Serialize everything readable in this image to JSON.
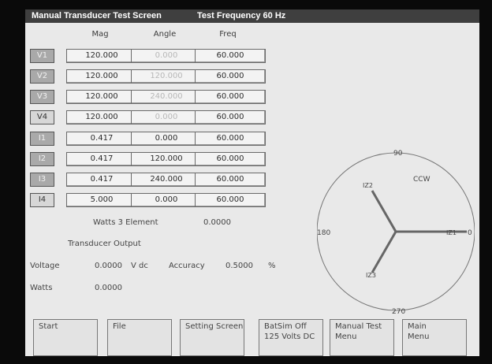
{
  "title": {
    "screen_name": "Manual Transducer Test Screen",
    "frequency": "Test Frequency 60 Hz"
  },
  "columns": {
    "mag": "Mag",
    "angle": "Angle",
    "freq": "Freq"
  },
  "rows": [
    {
      "channel": "V1",
      "mag": "120.000",
      "angle": "0.000",
      "freq": "60.000"
    },
    {
      "channel": "V2",
      "mag": "120.000",
      "angle": "120.000",
      "freq": "60.000"
    },
    {
      "channel": "V3",
      "mag": "120.000",
      "angle": "240.000",
      "freq": "60.000"
    },
    {
      "channel": "V4",
      "mag": "120.000",
      "angle": "0.000",
      "freq": "60.000"
    },
    {
      "channel": "I1",
      "mag": "0.417",
      "angle": "0.000",
      "freq": "60.000"
    },
    {
      "channel": "I2",
      "mag": "0.417",
      "angle": "120.000",
      "freq": "60.000"
    },
    {
      "channel": "I3",
      "mag": "0.417",
      "angle": "240.000",
      "freq": "60.000"
    },
    {
      "channel": "I4",
      "mag": "5.000",
      "angle": "0.000",
      "freq": "60.000"
    }
  ],
  "watts_element": {
    "label": "Watts 3 Element",
    "value": "0.0000"
  },
  "transducer": {
    "heading": "Transducer Output",
    "voltage_label": "Voltage",
    "voltage_value": "0.0000",
    "voltage_unit": "V dc",
    "accuracy_label": "Accuracy",
    "accuracy_value": "0.5000",
    "accuracy_unit": "%",
    "watts_label": "Watts",
    "watts_value": "0.0000"
  },
  "phasor": {
    "top": "90",
    "left": "180",
    "right": "0",
    "bottom": "270",
    "direction": "CCW",
    "labels": [
      "IZ1",
      "IZ2",
      "IZ3"
    ]
  },
  "softkeys": [
    {
      "line1": "Start",
      "line2": ""
    },
    {
      "line1": "File",
      "line2": ""
    },
    {
      "line1": "Setting Screen",
      "line2": ""
    },
    {
      "line1": "BatSim Off",
      "line2": "125 Volts DC"
    },
    {
      "line1": "Manual Test",
      "line2": "Menu"
    },
    {
      "line1": "Main",
      "line2": "Menu"
    }
  ],
  "colors": {
    "title_bar": "#3f3f3f",
    "screen_bg": "#e9e9e9",
    "channel_button": "#a9a9a9",
    "field_bg": "#f3f3f3",
    "phasor_line": "#666666"
  }
}
